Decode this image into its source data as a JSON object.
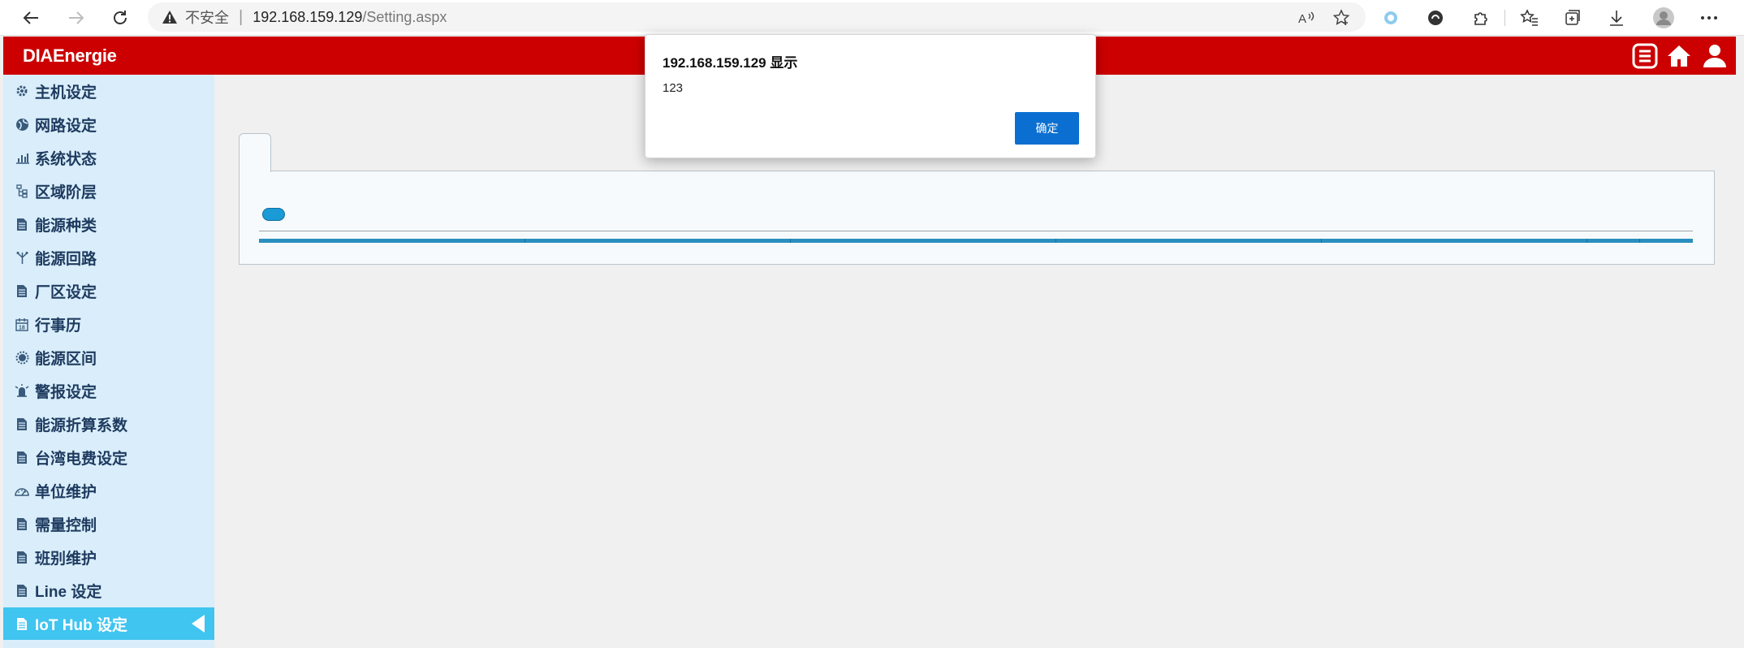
{
  "browser": {
    "insecure_label": "不安全",
    "url_host": "192.168.159.129",
    "url_path": "/Setting.aspx"
  },
  "app": {
    "brand": "DIAEnergie",
    "header_color": "#cc0000"
  },
  "sidebar": {
    "items": [
      {
        "label": "主机设定",
        "icon": "gear-icon"
      },
      {
        "label": "网路设定",
        "icon": "globe-icon"
      },
      {
        "label": "系统状态",
        "icon": "bar-chart-icon"
      },
      {
        "label": "区域阶层",
        "icon": "hierarchy-icon"
      },
      {
        "label": "能源种类",
        "icon": "document-icon"
      },
      {
        "label": "能源回路",
        "icon": "fork-icon"
      },
      {
        "label": "厂区设定",
        "icon": "document-icon"
      },
      {
        "label": "行事历",
        "icon": "calendar-icon"
      },
      {
        "label": "能源区间",
        "icon": "sun-icon"
      },
      {
        "label": "警报设定",
        "icon": "alarm-icon"
      },
      {
        "label": "能源折算系数",
        "icon": "document-icon"
      },
      {
        "label": "台湾电费设定",
        "icon": "document-icon"
      },
      {
        "label": "单位维护",
        "icon": "gauge-icon"
      },
      {
        "label": "需量控制",
        "icon": "document-icon"
      },
      {
        "label": "班别维护",
        "icon": "document-icon"
      },
      {
        "label": "Line 设定",
        "icon": "document-icon"
      },
      {
        "label": "IoT Hub 设定",
        "icon": "document-icon",
        "active": true
      }
    ],
    "active_color": "#40c4f0"
  },
  "dialog": {
    "title": "192.168.159.129 显示",
    "message": "123",
    "ok_label": "确定"
  }
}
